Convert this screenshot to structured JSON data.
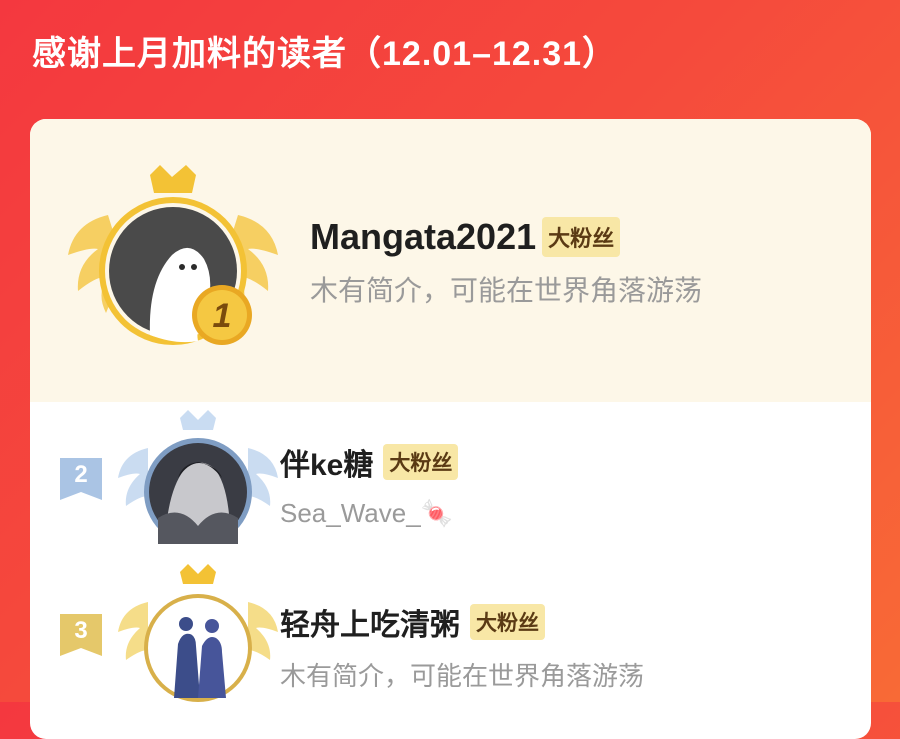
{
  "header": {
    "title": "感谢上月加料的读者（12.01–12.31）"
  },
  "colors": {
    "background_start": "#f4383f",
    "background_end": "#f86a36",
    "gold": "#f3c235",
    "silver": "#aac4e4",
    "badge_bg": "#f8e7a6"
  },
  "readers": [
    {
      "rank": "1",
      "name": "Mangata2021",
      "badge": "大粉丝",
      "bio": "木有简介，可能在世界角落游荡",
      "avatar": "default-ghost-avatar",
      "frame": "gold-crown-wings"
    },
    {
      "rank": "2",
      "name": "伴ke糖",
      "badge": "大粉丝",
      "bio": "Sea_Wave_🍬",
      "avatar": "ink-portrait-avatar",
      "frame": "silver-crown-wings"
    },
    {
      "rank": "3",
      "name": "轻舟上吃清粥",
      "badge": "大粉丝",
      "bio": "木有简介，可能在世界角落游荡",
      "avatar": "silhouette-couple-avatar",
      "frame": "gold-crown-wings"
    }
  ]
}
